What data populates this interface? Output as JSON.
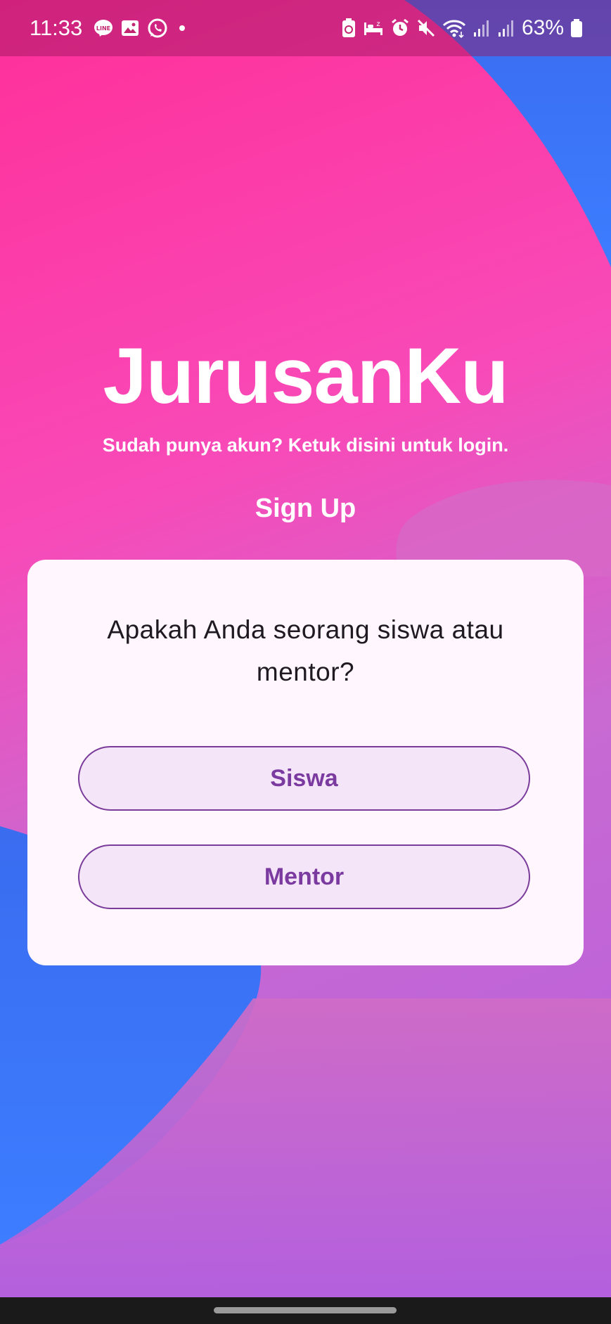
{
  "status_bar": {
    "time": "11:33",
    "notification_icons": [
      "line-icon",
      "gallery-icon",
      "whatsapp-icon",
      "dot-icon"
    ],
    "system_icons": [
      "battery-saver-icon",
      "sleep-icon",
      "alarm-icon",
      "mute-icon",
      "wifi-icon",
      "signal-icon",
      "signal-icon"
    ],
    "battery": "63%"
  },
  "app": {
    "title": "JurusanKu",
    "login_link": "Sudah punya akun? Ketuk disini untuk login.",
    "signup_heading": "Sign Up"
  },
  "card": {
    "question": "Apakah Anda seorang siswa atau mentor?",
    "buttons": {
      "siswa": "Siswa",
      "mentor": "Mentor"
    }
  },
  "colors": {
    "pink": "#ff2f99",
    "blue": "#3b7bff",
    "purple": "#b55de0",
    "button_text": "#7b3aa0",
    "button_border": "#7a3b9b",
    "card_bg": "#fff7fd"
  }
}
